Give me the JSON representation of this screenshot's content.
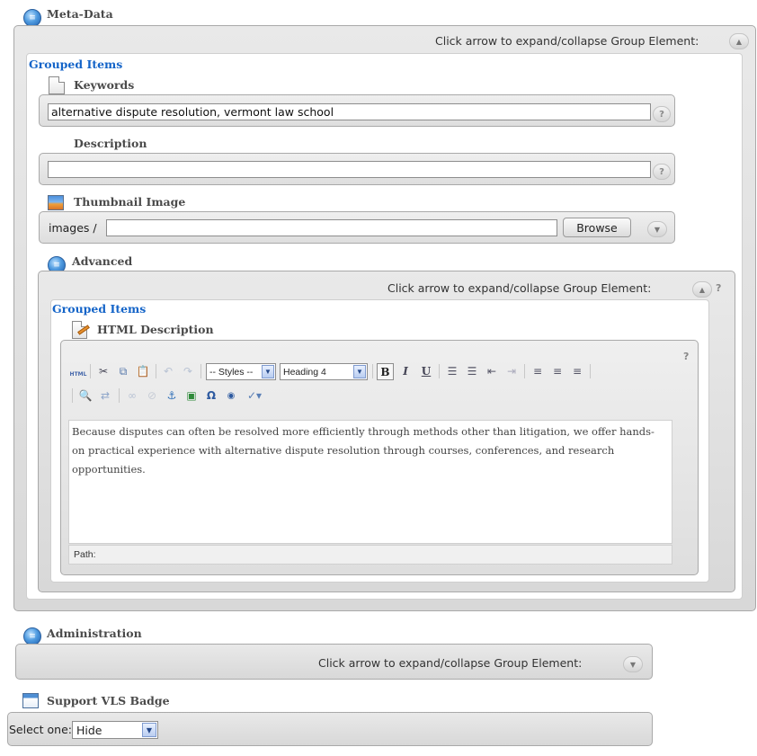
{
  "metadata": {
    "title": "Meta-Data",
    "collapse_text": "Click arrow to expand/collapse Group Element:",
    "grouped_items_label": "Grouped Items",
    "keywords": {
      "label": "Keywords",
      "value": "alternative dispute resolution, vermont law school",
      "help": "?"
    },
    "description": {
      "label": "Description",
      "value": "",
      "help": "?"
    },
    "thumbnail": {
      "label": "Thumbnail Image",
      "prefix": "images /",
      "value": "",
      "browse_label": "Browse"
    },
    "advanced": {
      "title": "Advanced",
      "collapse_text": "Click arrow to expand/collapse Group Element:",
      "help": "?",
      "grouped_items_label": "Grouped Items",
      "html_description": {
        "label": "HTML Description",
        "help": "?",
        "styles_value": "-- Styles --",
        "format_value": "Heading 4",
        "body_text": "Because disputes can often be resolved more efficiently through methods other than litigation, we offer hands-on practical experience with alternative dispute resolution through courses, conferences, and research opportunities.",
        "path_label": "Path:"
      }
    }
  },
  "administration": {
    "title": "Administration",
    "collapse_text": "Click arrow to expand/collapse Group Element:"
  },
  "support_badge": {
    "title": "Support VLS Badge",
    "select_label": "Select one:",
    "select_value": "Hide"
  },
  "icons": {
    "group": "blue-sphere-icon",
    "field": "document-icon",
    "image": "image-icon",
    "html": "html-edit-icon",
    "badge": "window-icon"
  },
  "colors": {
    "grouped_items": "#1464c8",
    "panel": "#e0e0e0",
    "border": "#a9a9a9"
  }
}
